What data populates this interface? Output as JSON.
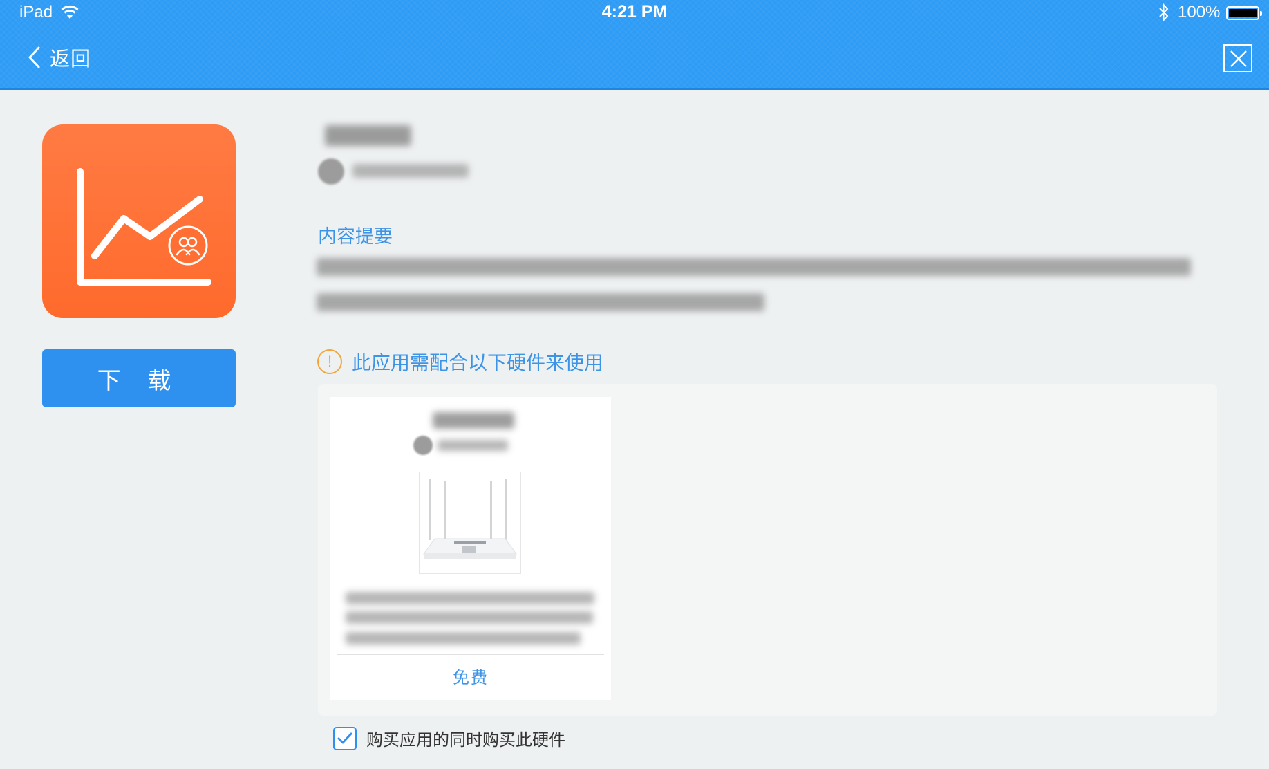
{
  "status_bar": {
    "device": "iPad",
    "time": "4:21 PM",
    "battery": "100%"
  },
  "nav": {
    "back_label": "返回"
  },
  "app": {
    "download_label": "下 载"
  },
  "summary": {
    "title": "内容提要"
  },
  "hardware": {
    "notice": "此应用需配合以下硬件来使用",
    "items": [
      {
        "price_label": "免费"
      }
    ],
    "bundle_label": "购买应用的同时购买此硬件",
    "bundle_checked": true
  },
  "colors": {
    "nav_bar": "#2e9bf5",
    "accent": "#2e91ef",
    "app_icon": "#ff6a2c",
    "warning": "#f3a53a",
    "link": "#3d94e6"
  },
  "icons": {
    "wifi": "wifi-icon",
    "bluetooth": "bluetooth-icon",
    "battery": "battery-icon",
    "back": "chevron-left-icon",
    "close": "close-icon",
    "app": "line-chart-group-icon",
    "warning": "exclamation-circle-icon",
    "checkbox": "checkmark-icon"
  }
}
